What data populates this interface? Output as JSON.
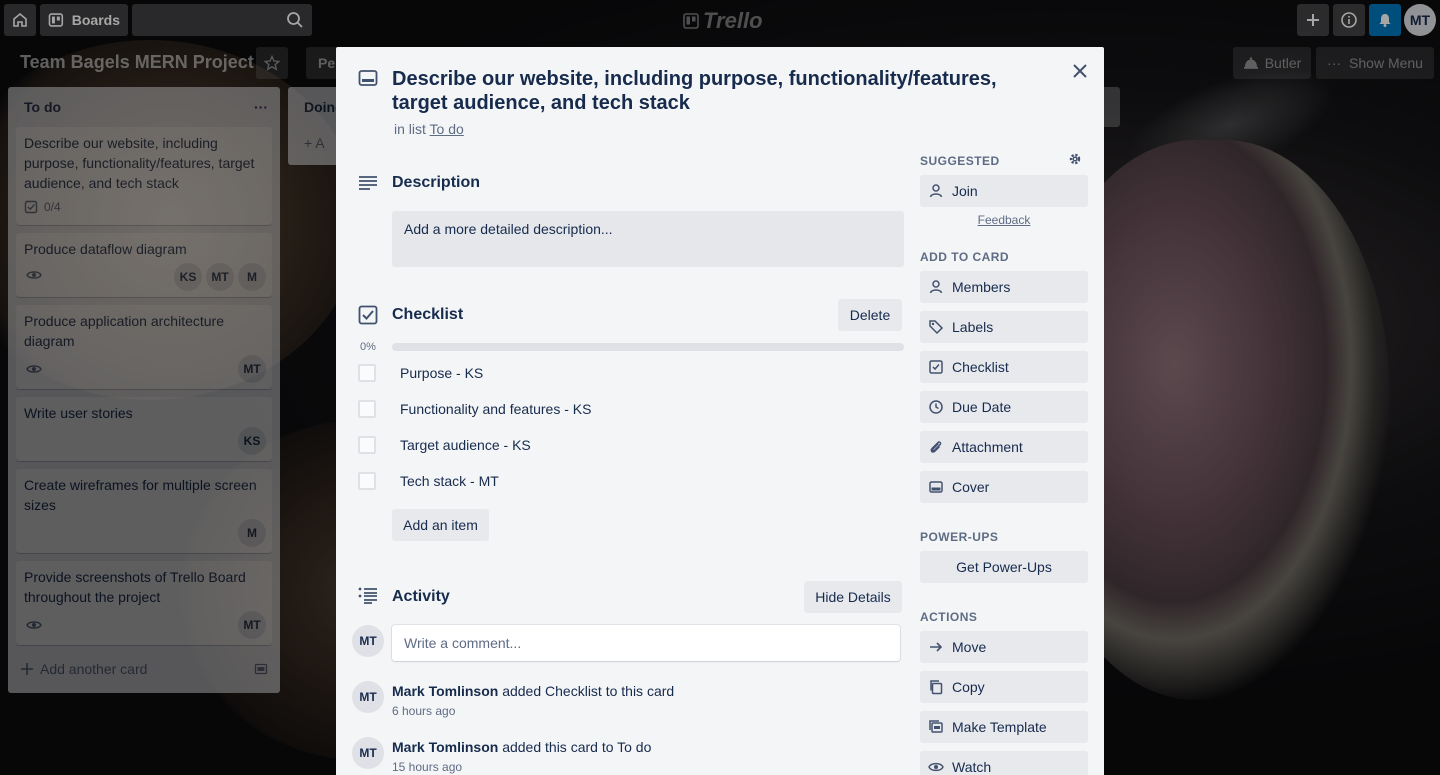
{
  "header": {
    "boards_label": "Boards",
    "logo_text": "Trello",
    "user_initials": "MT"
  },
  "board": {
    "title": "Team Bagels MERN Project",
    "permission_label": "Per",
    "butler_label": "Butler",
    "show_menu_label": "Show Menu"
  },
  "list_todo": {
    "title": "To do",
    "menu_glyph": "···",
    "cards": [
      {
        "title": "Describe our website, including purpose, functionality/features, target audience, and tech stack",
        "checklist_badge": "0/4",
        "members": []
      },
      {
        "title": "Produce dataflow diagram",
        "members": [
          "KS",
          "MT",
          "M"
        ]
      },
      {
        "title": "Produce application architecture diagram",
        "members": [
          "MT"
        ]
      },
      {
        "title": "Write user stories",
        "members": [
          "KS"
        ]
      },
      {
        "title": "Create wireframes for multiple screen sizes",
        "members": [
          "M"
        ]
      },
      {
        "title": "Provide screenshots of Trello Board throughout the project",
        "members": [
          "MT"
        ]
      }
    ],
    "add_card_label": "Add another card"
  },
  "list_doing": {
    "title": "Doing",
    "add_label": "A"
  },
  "card_modal": {
    "title": "Describe our website, including purpose, functionality/features, target audience, and tech stack",
    "in_list_prefix": "in list",
    "list_name": "To do",
    "description": {
      "heading": "Description",
      "placeholder": "Add a more detailed description..."
    },
    "checklist": {
      "heading": "Checklist",
      "delete_label": "Delete",
      "progress_label": "0%",
      "progress": 0,
      "items": [
        {
          "text": "Purpose - KS",
          "checked": false
        },
        {
          "text": "Functionality and features - KS",
          "checked": false
        },
        {
          "text": "Target audience - KS",
          "checked": false
        },
        {
          "text": "Tech stack - MT",
          "checked": false
        }
      ],
      "add_item_label": "Add an item"
    },
    "activity": {
      "heading": "Activity",
      "hide_details_label": "Hide Details",
      "comment_placeholder": "Write a comment...",
      "user_initials": "MT",
      "entries": [
        {
          "user": "Mark Tomlinson",
          "action": " added Checklist to this card",
          "time": "6 hours ago",
          "initials": "MT"
        },
        {
          "user": "Mark Tomlinson",
          "action": " added this card to To do",
          "time": "15 hours ago",
          "initials": "MT"
        }
      ]
    },
    "sidebar": {
      "suggested_heading": "SUGGESTED",
      "join_label": "Join",
      "feedback_label": "Feedback",
      "add_to_card_heading": "ADD TO CARD",
      "add_to_card": [
        "Members",
        "Labels",
        "Checklist",
        "Due Date",
        "Attachment",
        "Cover"
      ],
      "powerups_heading": "POWER-UPS",
      "get_powerups_label": "Get Power-Ups",
      "actions_heading": "ACTIONS",
      "actions": [
        "Move",
        "Copy",
        "Make Template",
        "Watch"
      ]
    }
  }
}
